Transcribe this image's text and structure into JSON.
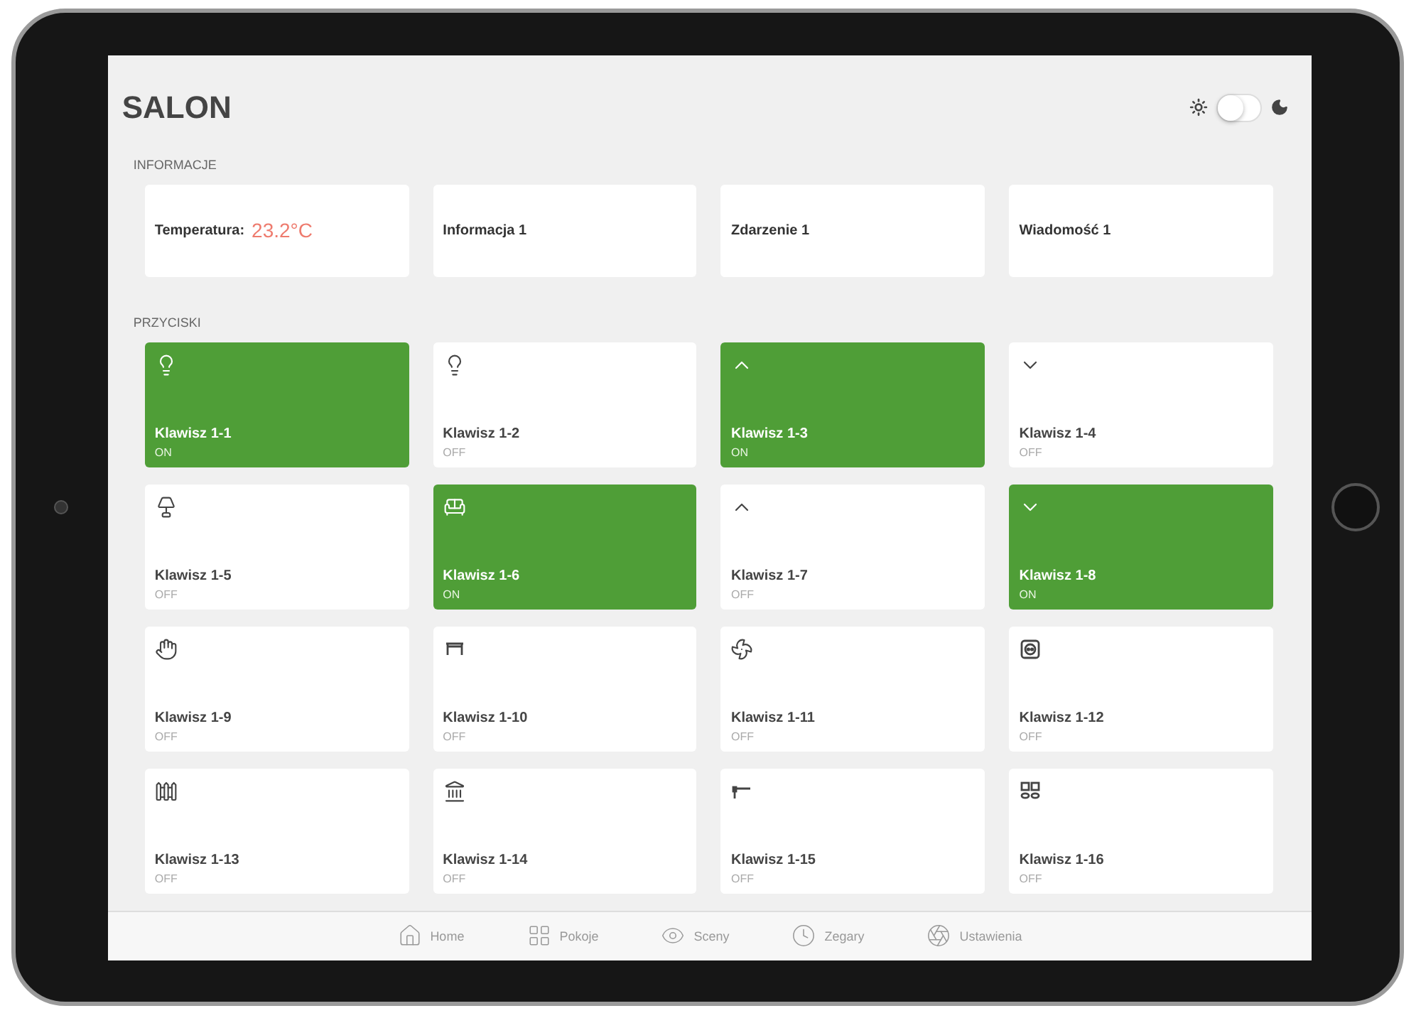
{
  "title": "SALON",
  "theme_switch": {
    "on": false
  },
  "info": {
    "heading": "INFORMACJE",
    "cards": [
      {
        "label": "Temperatura:",
        "value": "23.2°C"
      },
      {
        "label": "Informacja 1"
      },
      {
        "label": "Zdarzenie 1"
      },
      {
        "label": "Wiadomość 1"
      }
    ]
  },
  "buttons_section": {
    "heading": "PRZYCISKI",
    "buttons": [
      {
        "name": "Klawisz 1-1",
        "status": "ON",
        "on": true
      },
      {
        "name": "Klawisz 1-2",
        "status": "OFF",
        "on": false
      },
      {
        "name": "Klawisz 1-3",
        "status": "ON",
        "on": true
      },
      {
        "name": "Klawisz 1-4",
        "status": "OFF",
        "on": false
      },
      {
        "name": "Klawisz 1-5",
        "status": "OFF",
        "on": false
      },
      {
        "name": "Klawisz 1-6",
        "status": "ON",
        "on": true
      },
      {
        "name": "Klawisz 1-7",
        "status": "OFF",
        "on": false
      },
      {
        "name": "Klawisz 1-8",
        "status": "ON",
        "on": true
      },
      {
        "name": "Klawisz 1-9",
        "status": "OFF",
        "on": false
      },
      {
        "name": "Klawisz 1-10",
        "status": "OFF",
        "on": false
      },
      {
        "name": "Klawisz 1-11",
        "status": "OFF",
        "on": false
      },
      {
        "name": "Klawisz 1-12",
        "status": "OFF",
        "on": false
      },
      {
        "name": "Klawisz 1-13",
        "status": "OFF",
        "on": false
      },
      {
        "name": "Klawisz 1-14",
        "status": "OFF",
        "on": false
      },
      {
        "name": "Klawisz 1-15",
        "status": "OFF",
        "on": false
      },
      {
        "name": "Klawisz 1-16",
        "status": "OFF",
        "on": false
      }
    ]
  },
  "tab_bar": [
    {
      "label": "Home"
    },
    {
      "label": "Pokoje"
    },
    {
      "label": "Sceny"
    },
    {
      "label": "Zegary"
    },
    {
      "label": "Ustawienia"
    }
  ]
}
